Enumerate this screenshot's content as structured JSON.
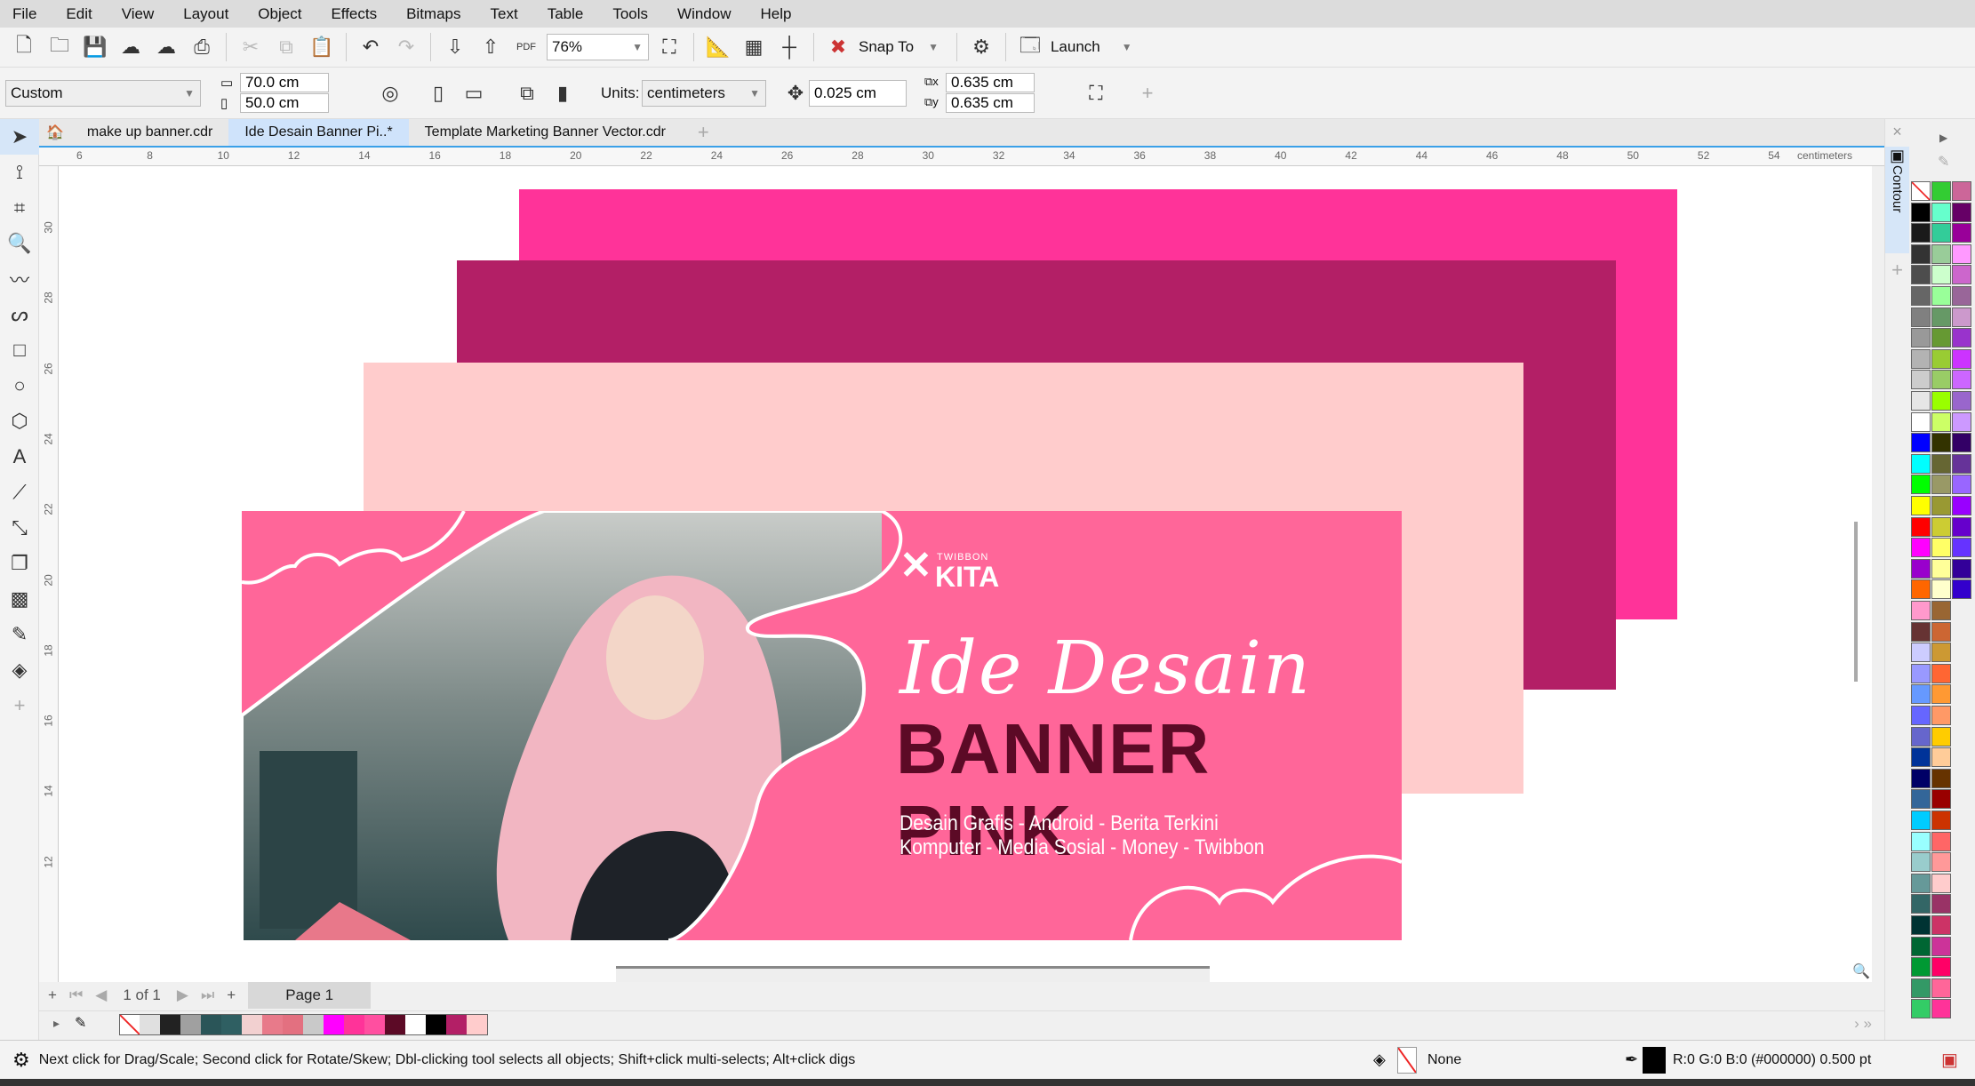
{
  "menu": [
    "File",
    "Edit",
    "View",
    "Layout",
    "Object",
    "Effects",
    "Bitmaps",
    "Text",
    "Table",
    "Tools",
    "Window",
    "Help"
  ],
  "toolbar": {
    "zoom": "76%",
    "snap_to": "Snap To",
    "launch": "Launch",
    "pdf": "PDF"
  },
  "property_bar": {
    "page_size": "Custom",
    "width": "70.0 cm",
    "height": "50.0 cm",
    "units_label": "Units:",
    "units": "centimeters",
    "nudge": "0.025 cm",
    "dup_x": "0.635 cm",
    "dup_y": "0.635 cm"
  },
  "tabs": [
    {
      "label": "make up banner.cdr"
    },
    {
      "label": "Ide Desain Banner Pi..*",
      "active": true
    },
    {
      "label": "Template Marketing Banner Vector.cdr"
    }
  ],
  "ruler": {
    "h_labels": [
      "6",
      "8",
      "10",
      "12",
      "14",
      "16",
      "18",
      "20",
      "22",
      "24",
      "26",
      "28",
      "30",
      "32",
      "34",
      "36",
      "38",
      "40",
      "42",
      "44",
      "46",
      "48",
      "50",
      "52",
      "54"
    ],
    "v_labels": [
      "30",
      "28",
      "26",
      "24",
      "22",
      "20",
      "18",
      "16",
      "14",
      "12"
    ],
    "unit": "centimeters"
  },
  "docker": {
    "label": "Contour"
  },
  "banner": {
    "logo_small": "TWIBBON",
    "logo_big": "KITA",
    "script_title": "Ide Desain",
    "title": "BANNER PINK",
    "line1": "Desain Grafis - Android - Berita Terkini",
    "line2": "Komputer - Media Sosial - Money - Twibbon"
  },
  "colors": {
    "rect1": "#FF3399",
    "rect2": "#B31F66",
    "rect3": "#FFCCCC",
    "banner": "#FF6699",
    "title": "#5C0A26"
  },
  "page_nav": {
    "count": "1 of 1",
    "page_tab": "Page 1"
  },
  "doc_palette": [
    "#e0e0e0",
    "#222222",
    "#a0a0a0",
    "#2a5558",
    "#2f5f62",
    "#f2d0d0",
    "#e87a8a",
    "#e37080",
    "#c9c9c9",
    "#ff00ff",
    "#ff3399",
    "#ff4fa0",
    "#5c0a26",
    "#ffffff",
    "#000000",
    "#b31f66",
    "#ffcccc"
  ],
  "palette": {
    "col1": [
      "#000000",
      "#1a1a1a",
      "#333333",
      "#4d4d4d",
      "#666666",
      "#808080",
      "#999999",
      "#b3b3b3",
      "#cccccc",
      "#e6e6e6",
      "#ffffff",
      "#0000ff",
      "#00ffff",
      "#00ff00",
      "#ffff00",
      "#ff0000",
      "#ff00ff",
      "#9900cc",
      "#ff6600",
      "#ff99cc",
      "#663333",
      "#ccccff",
      "#9999ff",
      "#6699ff",
      "#6666ff",
      "#6666cc",
      "#003399",
      "#000066",
      "#336699",
      "#00ccff",
      "#99ffff",
      "#99cccc",
      "#669999",
      "#336666",
      "#003333",
      "#006633",
      "#009933",
      "#339966",
      "#33cc66"
    ],
    "col2": [
      "#33cc33",
      "#66ffcc",
      "#33cc99",
      "#99cc99",
      "#ccffcc",
      "#99ff99",
      "#669966",
      "#669933",
      "#99cc33",
      "#99cc66",
      "#99ff00",
      "#ccff66",
      "#333300",
      "#666633",
      "#999966",
      "#999933",
      "#cccc33",
      "#ffff66",
      "#ffff99",
      "#ffffcc",
      "#996633",
      "#cc6633",
      "#cc9933",
      "#ff6633",
      "#ff9933",
      "#ff9966",
      "#ffcc00",
      "#ffcc99",
      "#663300",
      "#990000",
      "#cc3300",
      "#ff6666",
      "#ff9999",
      "#ffcccc",
      "#993366",
      "#cc3366",
      "#cc3399",
      "#ff0066",
      "#ff6699",
      "#ff3399"
    ],
    "col3": [
      "#cc6699",
      "#660066",
      "#990099",
      "#ff99ff",
      "#cc66cc",
      "#996699",
      "#cc99cc",
      "#9933cc",
      "#cc33ff",
      "#cc66ff",
      "#9966cc",
      "#cc99ff",
      "#330066",
      "#663399",
      "#9966ff",
      "#9900ff",
      "#6600cc",
      "#6633ff",
      "#330099",
      "#3300cc"
    ]
  },
  "status": {
    "hint": "Next click for Drag/Scale; Second click for Rotate/Skew; Dbl-clicking tool selects all objects; Shift+click multi-selects; Alt+click digs",
    "fill": "None",
    "outline": "R:0 G:0 B:0 (#000000)  0.500 pt"
  }
}
